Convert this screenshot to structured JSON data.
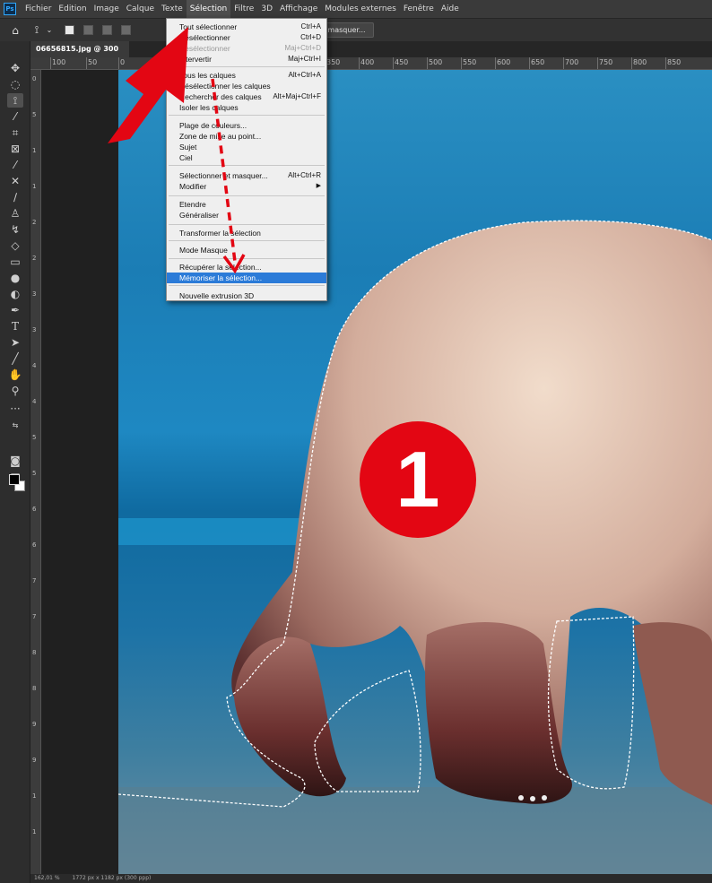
{
  "menubar": {
    "logo": "Ps",
    "items": [
      "Fichier",
      "Edition",
      "Image",
      "Calque",
      "Texte",
      "Sélection",
      "Filtre",
      "3D",
      "Affichage",
      "Modules externes",
      "Fenêtre",
      "Aide"
    ],
    "active_index": 5
  },
  "options": {
    "refine_label": "ner et masquer..."
  },
  "document": {
    "tab_title": "06656815.jpg @ 300"
  },
  "rulers": {
    "top_labels": [
      "100",
      "50",
      "0",
      "350",
      "400",
      "450",
      "500",
      "550",
      "600",
      "650",
      "700",
      "750",
      "800",
      "850"
    ],
    "left_labels": [
      "0",
      "5",
      "1",
      "1",
      "2",
      "2",
      "3",
      "3",
      "4",
      "4",
      "5",
      "5",
      "6",
      "6",
      "7",
      "7",
      "8",
      "8",
      "9",
      "9",
      "1",
      "1"
    ]
  },
  "status": {
    "zoom": "162,01 %",
    "size": "1772 px x 1182 px (300 ppp)"
  },
  "selection_menu": {
    "items": [
      {
        "label": "Tout sélectionner",
        "shortcut": "Ctrl+A",
        "state": "normal"
      },
      {
        "label": "Désélectionner",
        "shortcut": "Ctrl+D",
        "state": "normal"
      },
      {
        "label": "Resélectionner",
        "shortcut": "Maj+Ctrl+D",
        "state": "disabled"
      },
      {
        "label": "Intervertir",
        "shortcut": "Maj+Ctrl+I",
        "state": "normal"
      },
      {
        "label": "Tous les calques",
        "shortcut": "Alt+Ctrl+A",
        "state": "normal"
      },
      {
        "label": "Désélectionner les calques",
        "shortcut": "",
        "state": "normal"
      },
      {
        "label": "Rechercher des calques",
        "shortcut": "Alt+Maj+Ctrl+F",
        "state": "normal"
      },
      {
        "label": "Isoler les calques",
        "shortcut": "",
        "state": "normal"
      },
      {
        "label": "Plage de couleurs...",
        "shortcut": "",
        "state": "normal"
      },
      {
        "label": "Zone de mise au point...",
        "shortcut": "",
        "state": "normal"
      },
      {
        "label": "Sujet",
        "shortcut": "",
        "state": "normal"
      },
      {
        "label": "Ciel",
        "shortcut": "",
        "state": "normal"
      },
      {
        "label": "Sélectionner et masquer...",
        "shortcut": "Alt+Ctrl+R",
        "state": "normal"
      },
      {
        "label": "Modifier",
        "shortcut": "",
        "state": "submenu"
      },
      {
        "label": "Etendre",
        "shortcut": "",
        "state": "normal"
      },
      {
        "label": "Généraliser",
        "shortcut": "",
        "state": "normal"
      },
      {
        "label": "Transformer la sélection",
        "shortcut": "",
        "state": "normal"
      },
      {
        "label": "Mode Masque",
        "shortcut": "",
        "state": "normal"
      },
      {
        "label": "Récupérer la sélection...",
        "shortcut": "",
        "state": "normal"
      },
      {
        "label": "Mémoriser la sélection...",
        "shortcut": "",
        "state": "highlighted"
      },
      {
        "label": "Nouvelle extrusion 3D",
        "shortcut": "",
        "state": "normal"
      }
    ]
  },
  "annotation": {
    "step_number": "1",
    "arrow_color": "#e30613",
    "highlight_color": "#2b7bd8"
  },
  "tools": [
    "move-tool-icon",
    "marquee-tool-icon",
    "lasso-tool-icon",
    "magic-wand-icon",
    "crop-tool-icon",
    "frame-tool-icon",
    "eyedropper-icon",
    "healing-brush-icon",
    "brush-tool-icon",
    "stamp-tool-icon",
    "history-brush-icon",
    "eraser-icon",
    "gradient-tool-icon",
    "blur-tool-icon",
    "dodge-tool-icon",
    "pen-tool-icon",
    "type-tool-icon",
    "path-selection-icon",
    "line-tool-icon",
    "hand-tool-icon",
    "zoom-tool-icon",
    "more-tools-icon"
  ]
}
